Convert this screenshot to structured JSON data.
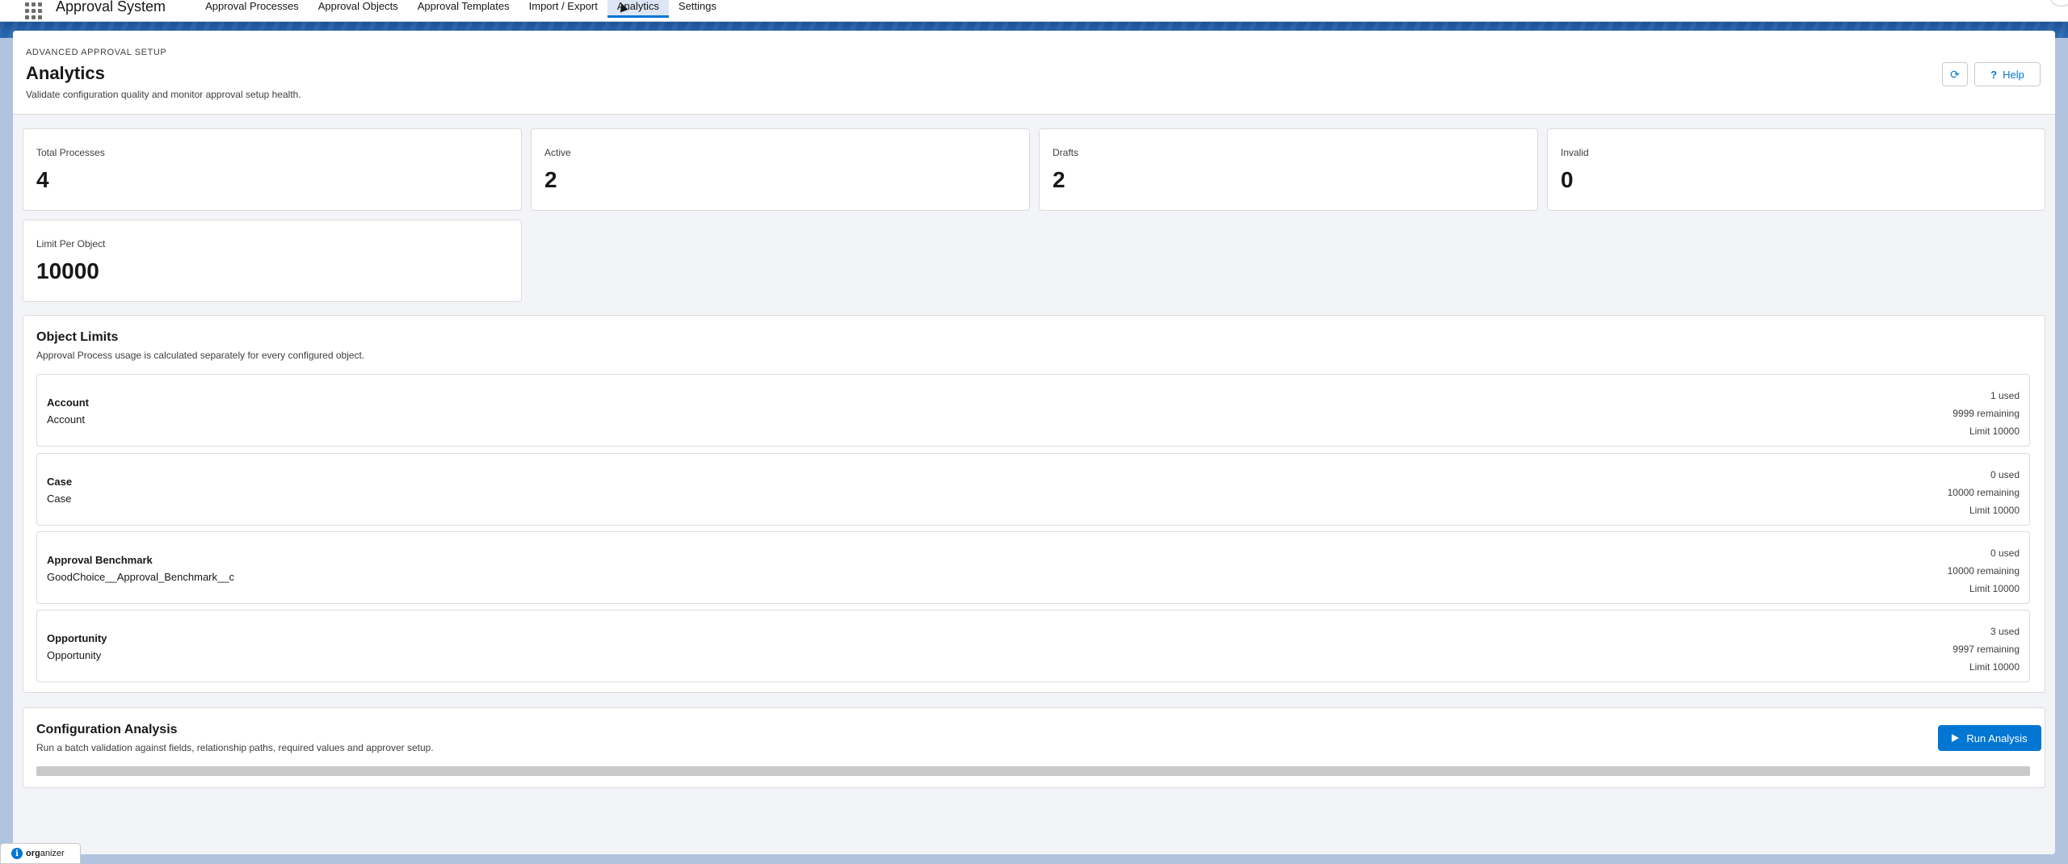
{
  "nav": {
    "app_name": "Approval System",
    "tabs": [
      {
        "label": "Approval Processes"
      },
      {
        "label": "Approval Objects"
      },
      {
        "label": "Approval Templates"
      },
      {
        "label": "Import / Export"
      },
      {
        "label": "Analytics"
      },
      {
        "label": "Settings"
      }
    ],
    "active_tab": "Analytics"
  },
  "header": {
    "eyebrow": "ADVANCED APPROVAL SETUP",
    "title": "Analytics",
    "subtitle": "Validate configuration quality and monitor approval setup health.",
    "refresh_icon": "refresh-icon",
    "help_label": "Help",
    "help_icon": "question-icon"
  },
  "stats": [
    {
      "label": "Total Processes",
      "value": "4"
    },
    {
      "label": "Active",
      "value": "2"
    },
    {
      "label": "Drafts",
      "value": "2"
    },
    {
      "label": "Invalid",
      "value": "0"
    },
    {
      "label": "Limit Per Object",
      "value": "10000"
    }
  ],
  "object_limits": {
    "title": "Object Limits",
    "subtitle": "Approval Process usage is calculated separately for every configured object.",
    "objects": [
      {
        "name": "Account",
        "api_name": "Account",
        "used": "1 used",
        "remaining": "9999 remaining",
        "limit": "Limit 10000"
      },
      {
        "name": "Case",
        "api_name": "Case",
        "used": "0 used",
        "remaining": "10000 remaining",
        "limit": "Limit 10000"
      },
      {
        "name": "Approval Benchmark",
        "api_name": "GoodChoice__Approval_Benchmark__c",
        "used": "0 used",
        "remaining": "10000 remaining",
        "limit": "Limit 10000"
      },
      {
        "name": "Opportunity",
        "api_name": "Opportunity",
        "used": "3 used",
        "remaining": "9997 remaining",
        "limit": "Limit 10000"
      }
    ]
  },
  "config_analysis": {
    "title": "Configuration Analysis",
    "subtitle": "Run a batch validation against fields, relationship paths, required values and approver setup.",
    "run_label": "Run Analysis",
    "progress": 0
  },
  "utility_bar": {
    "prefix": "org",
    "suffix": "anizer"
  },
  "colors": {
    "brand": "#0176d3",
    "active_tab_bg": "#dce6f5",
    "band": "#1b5297"
  }
}
